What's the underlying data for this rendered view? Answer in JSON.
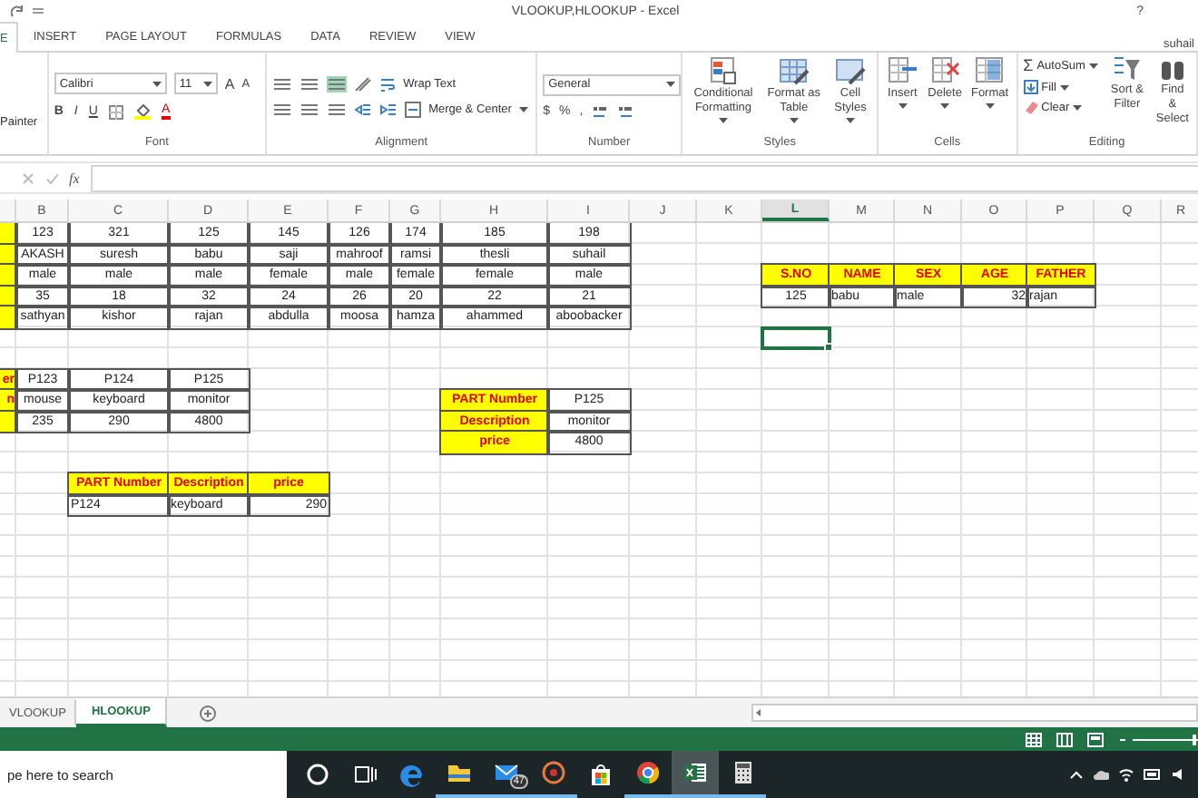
{
  "title_bar": {
    "title": "VLOOKUP,HLOOKUP - Excel",
    "help": "?"
  },
  "tabs": [
    {
      "label": "E",
      "selected": true
    },
    {
      "label": "INSERT",
      "selected": false
    },
    {
      "label": "PAGE LAYOUT",
      "selected": false
    },
    {
      "label": "FORMULAS",
      "selected": false
    },
    {
      "label": "DATA",
      "selected": false
    },
    {
      "label": "REVIEW",
      "selected": false
    },
    {
      "label": "VIEW",
      "selected": false
    }
  ],
  "user": "suhail",
  "ribbon": {
    "groups": [
      {
        "kind": "clipboard",
        "button": "Painter"
      },
      {
        "kind": "font",
        "label": "Font",
        "font_name": "Calibri",
        "font_size": "11",
        "size_buttons": [
          "A",
          "A"
        ],
        "format_buttons": [
          "B",
          "I",
          "U"
        ],
        "font_color_glyph": "A"
      },
      {
        "kind": "alignment",
        "label": "Alignment",
        "wrap": "Wrap Text",
        "merge": "Merge & Center"
      },
      {
        "kind": "number",
        "label": "Number",
        "format": "General",
        "buttons": [
          "$",
          "%",
          ","
        ]
      },
      {
        "kind": "styles",
        "label": "Styles",
        "buttons": [
          "Conditional Formatting",
          "Format as Table",
          "Cell Styles"
        ]
      },
      {
        "kind": "cells",
        "label": "Cells",
        "buttons": [
          "Insert",
          "Delete",
          "Format"
        ]
      },
      {
        "kind": "editing",
        "label": "Editing",
        "sum_glyph": "Σ",
        "small": [
          "AutoSum",
          "Fill",
          "Clear"
        ],
        "large": [
          "Sort & Filter",
          "Find & Select"
        ]
      }
    ]
  },
  "formula_bar": {
    "fx": "fx"
  },
  "columns": [
    {
      "selected": false
    },
    {
      "label": "B",
      "selected": false
    },
    {
      "label": "C",
      "selected": false
    },
    {
      "label": "D",
      "selected": false
    },
    {
      "label": "E",
      "selected": false
    },
    {
      "label": "F",
      "selected": false
    },
    {
      "label": "G",
      "selected": false
    },
    {
      "label": "H",
      "selected": false
    },
    {
      "label": "I",
      "selected": false
    },
    {
      "label": "J",
      "selected": false
    },
    {
      "label": "K",
      "selected": false
    },
    {
      "label": "L",
      "selected": true
    },
    {
      "label": "M",
      "selected": false
    },
    {
      "label": "N",
      "selected": false
    },
    {
      "label": "O",
      "selected": false
    },
    {
      "label": "P",
      "selected": false
    },
    {
      "label": "Q",
      "selected": false
    },
    {
      "label": "R",
      "selected": false
    }
  ],
  "rows": [
    {
      "cells": [
        {
          "kind": "header"
        },
        {
          "kind": "center",
          "text": "123"
        },
        {
          "kind": "center",
          "text": "321"
        },
        {
          "kind": "center",
          "text": "125"
        },
        {
          "kind": "center",
          "text": "145"
        },
        {
          "kind": "center",
          "text": "126"
        },
        {
          "kind": "center",
          "text": "174"
        },
        {
          "kind": "center",
          "text": "185"
        },
        {
          "kind": "center",
          "text": "198"
        }
      ]
    },
    {
      "cells": [
        {
          "kind": "header"
        },
        {
          "kind": "center",
          "text": "AKASH"
        },
        {
          "kind": "center",
          "text": "suresh"
        },
        {
          "kind": "center",
          "text": "babu"
        },
        {
          "kind": "center",
          "text": "saji"
        },
        {
          "kind": "center",
          "text": "mahroof"
        },
        {
          "kind": "center",
          "text": "ramsi"
        },
        {
          "kind": "center",
          "text": "thesli"
        },
        {
          "kind": "center",
          "text": "suhail"
        }
      ]
    },
    {
      "cells": [
        {
          "kind": "header"
        },
        {
          "kind": "center",
          "text": "male"
        },
        {
          "kind": "center",
          "text": "male"
        },
        {
          "kind": "center",
          "text": "male"
        },
        {
          "kind": "center",
          "text": "female"
        },
        {
          "kind": "center",
          "text": "male"
        },
        {
          "kind": "center",
          "text": "female"
        },
        {
          "kind": "center",
          "text": "female"
        },
        {
          "kind": "center",
          "text": "male"
        },
        {
          "kind": "blank"
        },
        {
          "kind": "blank"
        },
        {
          "kind": "header",
          "text": "S.NO"
        },
        {
          "kind": "header",
          "text": "NAME"
        },
        {
          "kind": "header",
          "text": "SEX"
        },
        {
          "kind": "header",
          "text": "AGE"
        },
        {
          "kind": "header",
          "text": "FATHER"
        }
      ]
    },
    {
      "cells": [
        {
          "kind": "header"
        },
        {
          "kind": "center",
          "text": "35"
        },
        {
          "kind": "center",
          "text": "18"
        },
        {
          "kind": "center",
          "text": "32"
        },
        {
          "kind": "center",
          "text": "24"
        },
        {
          "kind": "center",
          "text": "26"
        },
        {
          "kind": "center",
          "text": "20"
        },
        {
          "kind": "center",
          "text": "22"
        },
        {
          "kind": "center",
          "text": "21"
        },
        {
          "kind": "blank"
        },
        {
          "kind": "blank"
        },
        {
          "kind": "center",
          "text": "125"
        },
        {
          "kind": "left",
          "text": "babu"
        },
        {
          "kind": "left",
          "text": "male"
        },
        {
          "kind": "right",
          "text": "32"
        },
        {
          "kind": "left",
          "text": "rajan"
        }
      ]
    },
    {
      "cells": [
        {
          "kind": "header"
        },
        {
          "kind": "center",
          "text": "sathyan"
        },
        {
          "kind": "center",
          "text": "kishor"
        },
        {
          "kind": "center",
          "text": "rajan"
        },
        {
          "kind": "center",
          "text": "abdulla"
        },
        {
          "kind": "center",
          "text": "moosa"
        },
        {
          "kind": "center",
          "text": "hamza"
        },
        {
          "kind": "center",
          "text": "ahammed"
        },
        {
          "kind": "center",
          "text": "aboobacker"
        }
      ]
    },
    {
      "cells": [
        {
          "kind": "blank"
        },
        {
          "kind": "blank"
        },
        {
          "kind": "blank"
        },
        {
          "kind": "blank"
        },
        {
          "kind": "blank"
        },
        {
          "kind": "blank"
        },
        {
          "kind": "blank"
        },
        {
          "kind": "blank"
        },
        {
          "kind": "blank"
        },
        {
          "kind": "blank"
        },
        {
          "kind": "blank"
        },
        {
          "kind": "active"
        }
      ]
    },
    {},
    {
      "cells": [
        {
          "kind": "header_cut",
          "text": "er"
        },
        {
          "kind": "center",
          "text": "P123"
        },
        {
          "kind": "center",
          "text": "P124"
        },
        {
          "kind": "center",
          "text": "P125"
        }
      ]
    },
    {
      "cells": [
        {
          "kind": "header_cut",
          "text": "n"
        },
        {
          "kind": "center",
          "text": "mouse"
        },
        {
          "kind": "center",
          "text": "keyboard"
        },
        {
          "kind": "center",
          "text": "monitor"
        },
        {
          "kind": "blank"
        },
        {
          "kind": "blank"
        },
        {
          "kind": "blank"
        },
        {
          "kind": "header",
          "text": "PART Number"
        },
        {
          "kind": "center",
          "text": "P125"
        }
      ]
    },
    {
      "cells": [
        {
          "kind": "header"
        },
        {
          "kind": "center",
          "text": "235"
        },
        {
          "kind": "center",
          "text": "290"
        },
        {
          "kind": "center",
          "text": "4800"
        },
        {
          "kind": "blank"
        },
        {
          "kind": "blank"
        },
        {
          "kind": "blank"
        },
        {
          "kind": "header",
          "text": "Description"
        },
        {
          "kind": "center",
          "text": "monitor"
        }
      ]
    },
    {
      "cells": [
        {
          "kind": "blank"
        },
        {
          "kind": "blank"
        },
        {
          "kind": "blank"
        },
        {
          "kind": "blank"
        },
        {
          "kind": "blank"
        },
        {
          "kind": "blank"
        },
        {
          "kind": "blank"
        },
        {
          "kind": "header",
          "text": "price"
        },
        {
          "kind": "center",
          "text": "4800"
        }
      ]
    },
    {},
    {
      "cells": [
        {
          "kind": "blank"
        },
        {
          "kind": "blank"
        },
        {
          "kind": "header",
          "text": "PART Number"
        },
        {
          "kind": "header",
          "text": "Description"
        },
        {
          "kind": "header",
          "text": "price"
        }
      ]
    },
    {
      "cells": [
        {
          "kind": "blank"
        },
        {
          "kind": "blank"
        },
        {
          "kind": "left",
          "text": "P124"
        },
        {
          "kind": "left",
          "text": "keyboard"
        },
        {
          "kind": "right",
          "text": "290"
        }
      ]
    },
    {},
    {},
    {},
    {},
    {},
    {},
    {},
    {},
    {}
  ],
  "sheet_tabs": [
    {
      "label": "VLOOKUP",
      "selected": false
    },
    {
      "label": "HLOOKUP",
      "selected": true
    }
  ],
  "taskbar": {
    "search_placeholder": "pe here to search",
    "apps": [
      {
        "kind": "cortana",
        "running": false,
        "active": false
      },
      {
        "kind": "task_view",
        "running": false,
        "active": false
      },
      {
        "kind": "edge",
        "running": false,
        "active": false
      },
      {
        "kind": "explorer",
        "running": true,
        "active": false
      },
      {
        "kind": "mail",
        "running": true,
        "active": false,
        "badge": "47"
      },
      {
        "kind": "media",
        "running": true,
        "active": false
      },
      {
        "kind": "store",
        "running": false,
        "active": false
      },
      {
        "kind": "chrome",
        "running": true,
        "active": false
      },
      {
        "kind": "excel",
        "running": true,
        "active": true
      },
      {
        "kind": "calculator",
        "running": true,
        "active": false
      }
    ]
  }
}
